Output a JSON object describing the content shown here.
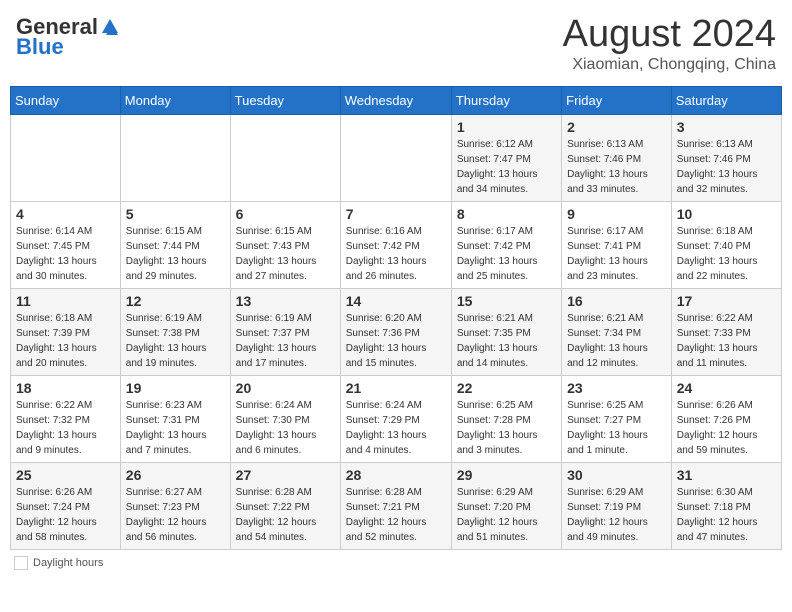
{
  "header": {
    "logo_line1": "General",
    "logo_line2": "Blue",
    "main_title": "August 2024",
    "subtitle": "Xiaomian, Chongqing, China"
  },
  "weekdays": [
    "Sunday",
    "Monday",
    "Tuesday",
    "Wednesday",
    "Thursday",
    "Friday",
    "Saturday"
  ],
  "weeks": [
    [
      {
        "day": "",
        "detail": ""
      },
      {
        "day": "",
        "detail": ""
      },
      {
        "day": "",
        "detail": ""
      },
      {
        "day": "",
        "detail": ""
      },
      {
        "day": "1",
        "detail": "Sunrise: 6:12 AM\nSunset: 7:47 PM\nDaylight: 13 hours\nand 34 minutes."
      },
      {
        "day": "2",
        "detail": "Sunrise: 6:13 AM\nSunset: 7:46 PM\nDaylight: 13 hours\nand 33 minutes."
      },
      {
        "day": "3",
        "detail": "Sunrise: 6:13 AM\nSunset: 7:46 PM\nDaylight: 13 hours\nand 32 minutes."
      }
    ],
    [
      {
        "day": "4",
        "detail": "Sunrise: 6:14 AM\nSunset: 7:45 PM\nDaylight: 13 hours\nand 30 minutes."
      },
      {
        "day": "5",
        "detail": "Sunrise: 6:15 AM\nSunset: 7:44 PM\nDaylight: 13 hours\nand 29 minutes."
      },
      {
        "day": "6",
        "detail": "Sunrise: 6:15 AM\nSunset: 7:43 PM\nDaylight: 13 hours\nand 27 minutes."
      },
      {
        "day": "7",
        "detail": "Sunrise: 6:16 AM\nSunset: 7:42 PM\nDaylight: 13 hours\nand 26 minutes."
      },
      {
        "day": "8",
        "detail": "Sunrise: 6:17 AM\nSunset: 7:42 PM\nDaylight: 13 hours\nand 25 minutes."
      },
      {
        "day": "9",
        "detail": "Sunrise: 6:17 AM\nSunset: 7:41 PM\nDaylight: 13 hours\nand 23 minutes."
      },
      {
        "day": "10",
        "detail": "Sunrise: 6:18 AM\nSunset: 7:40 PM\nDaylight: 13 hours\nand 22 minutes."
      }
    ],
    [
      {
        "day": "11",
        "detail": "Sunrise: 6:18 AM\nSunset: 7:39 PM\nDaylight: 13 hours\nand 20 minutes."
      },
      {
        "day": "12",
        "detail": "Sunrise: 6:19 AM\nSunset: 7:38 PM\nDaylight: 13 hours\nand 19 minutes."
      },
      {
        "day": "13",
        "detail": "Sunrise: 6:19 AM\nSunset: 7:37 PM\nDaylight: 13 hours\nand 17 minutes."
      },
      {
        "day": "14",
        "detail": "Sunrise: 6:20 AM\nSunset: 7:36 PM\nDaylight: 13 hours\nand 15 minutes."
      },
      {
        "day": "15",
        "detail": "Sunrise: 6:21 AM\nSunset: 7:35 PM\nDaylight: 13 hours\nand 14 minutes."
      },
      {
        "day": "16",
        "detail": "Sunrise: 6:21 AM\nSunset: 7:34 PM\nDaylight: 13 hours\nand 12 minutes."
      },
      {
        "day": "17",
        "detail": "Sunrise: 6:22 AM\nSunset: 7:33 PM\nDaylight: 13 hours\nand 11 minutes."
      }
    ],
    [
      {
        "day": "18",
        "detail": "Sunrise: 6:22 AM\nSunset: 7:32 PM\nDaylight: 13 hours\nand 9 minutes."
      },
      {
        "day": "19",
        "detail": "Sunrise: 6:23 AM\nSunset: 7:31 PM\nDaylight: 13 hours\nand 7 minutes."
      },
      {
        "day": "20",
        "detail": "Sunrise: 6:24 AM\nSunset: 7:30 PM\nDaylight: 13 hours\nand 6 minutes."
      },
      {
        "day": "21",
        "detail": "Sunrise: 6:24 AM\nSunset: 7:29 PM\nDaylight: 13 hours\nand 4 minutes."
      },
      {
        "day": "22",
        "detail": "Sunrise: 6:25 AM\nSunset: 7:28 PM\nDaylight: 13 hours\nand 3 minutes."
      },
      {
        "day": "23",
        "detail": "Sunrise: 6:25 AM\nSunset: 7:27 PM\nDaylight: 13 hours\nand 1 minute."
      },
      {
        "day": "24",
        "detail": "Sunrise: 6:26 AM\nSunset: 7:26 PM\nDaylight: 12 hours\nand 59 minutes."
      }
    ],
    [
      {
        "day": "25",
        "detail": "Sunrise: 6:26 AM\nSunset: 7:24 PM\nDaylight: 12 hours\nand 58 minutes."
      },
      {
        "day": "26",
        "detail": "Sunrise: 6:27 AM\nSunset: 7:23 PM\nDaylight: 12 hours\nand 56 minutes."
      },
      {
        "day": "27",
        "detail": "Sunrise: 6:28 AM\nSunset: 7:22 PM\nDaylight: 12 hours\nand 54 minutes."
      },
      {
        "day": "28",
        "detail": "Sunrise: 6:28 AM\nSunset: 7:21 PM\nDaylight: 12 hours\nand 52 minutes."
      },
      {
        "day": "29",
        "detail": "Sunrise: 6:29 AM\nSunset: 7:20 PM\nDaylight: 12 hours\nand 51 minutes."
      },
      {
        "day": "30",
        "detail": "Sunrise: 6:29 AM\nSunset: 7:19 PM\nDaylight: 12 hours\nand 49 minutes."
      },
      {
        "day": "31",
        "detail": "Sunrise: 6:30 AM\nSunset: 7:18 PM\nDaylight: 12 hours\nand 47 minutes."
      }
    ]
  ],
  "footer": {
    "daylight_label": "Daylight hours"
  }
}
